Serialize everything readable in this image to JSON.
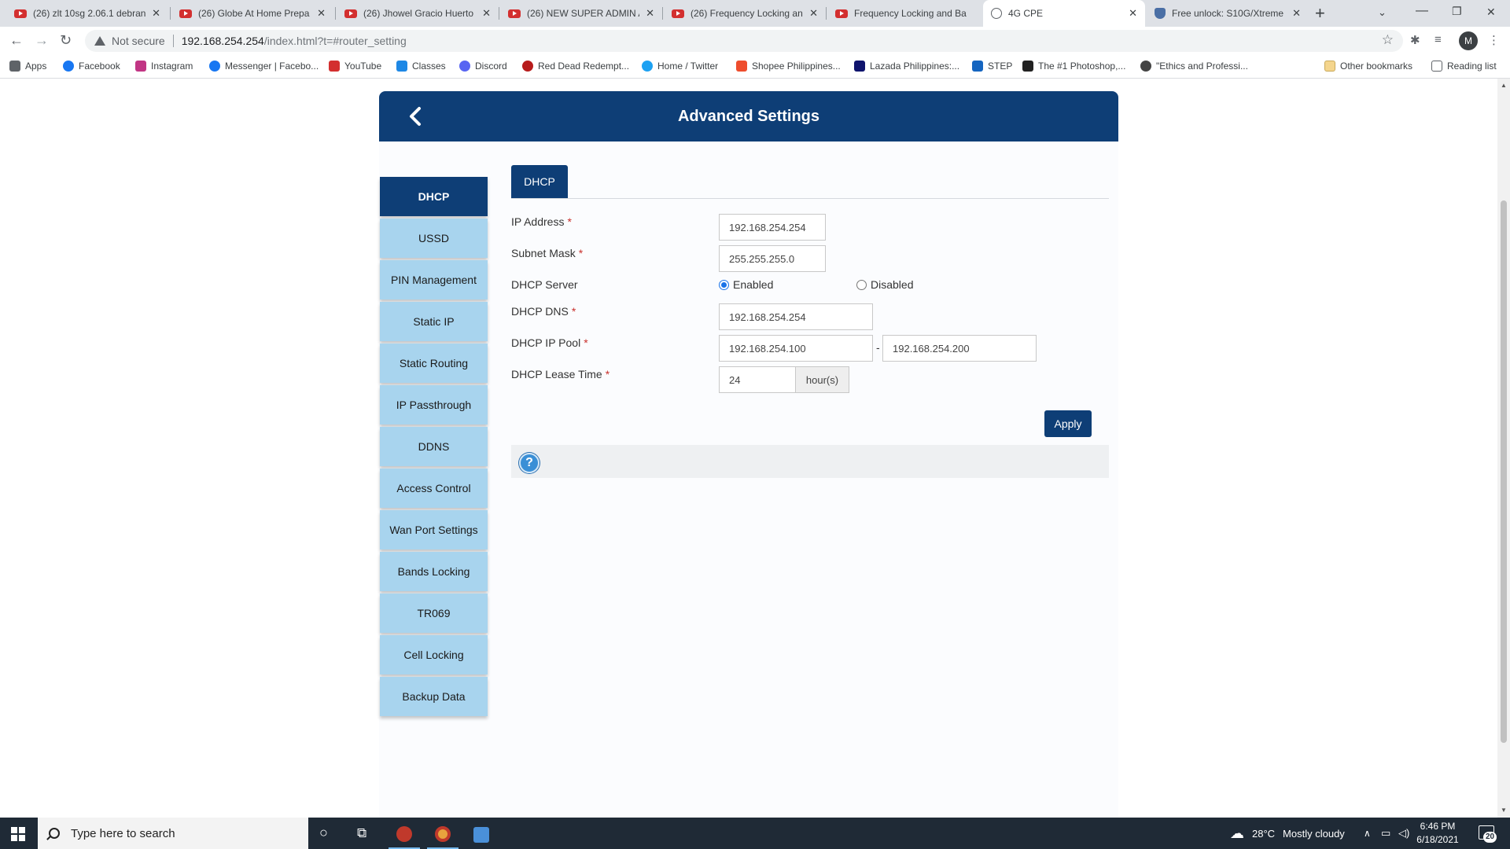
{
  "browser": {
    "tabs": [
      {
        "title": "(26) zlt 10sg 2.06.1 debran",
        "icon": "youtube-icon"
      },
      {
        "title": "(26) Globe At Home Prepa",
        "icon": "youtube-icon"
      },
      {
        "title": "(26) Jhowel Gracio Huerto",
        "icon": "youtube-icon"
      },
      {
        "title": "(26) NEW SUPER ADMIN A",
        "icon": "youtube-icon"
      },
      {
        "title": "(26) Frequency Locking an",
        "icon": "youtube-icon"
      },
      {
        "title": "Frequency Locking and Ba",
        "icon": "youtube-icon"
      },
      {
        "title": "4G CPE",
        "icon": "globe-icon"
      },
      {
        "title": "Free unlock: S10G/Xtreme",
        "icon": "shield-icon"
      }
    ],
    "new_tab_label": "+",
    "window_controls": {
      "minimize": "—",
      "restore": "❐",
      "close": "✕"
    },
    "nav": {
      "back": "←",
      "forward": "→",
      "reload": "↻"
    },
    "address_bar": {
      "security_label": "Not secure",
      "host": "192.168.254.254",
      "path": "/index.html?t=#router_setting"
    },
    "profile_initial": "M",
    "bookmarks": [
      {
        "label": "Apps",
        "color": "#5f6368"
      },
      {
        "label": "Facebook",
        "color": "#1877f2"
      },
      {
        "label": "Instagram",
        "color": "#c13584"
      },
      {
        "label": "Messenger | Facebo...",
        "color": "#1877f2"
      },
      {
        "label": "YouTube",
        "color": "#d32f2f"
      },
      {
        "label": "Classes",
        "color": "#1e88e5"
      },
      {
        "label": "Discord",
        "color": "#5865f2"
      },
      {
        "label": "Red Dead Redempt...",
        "color": "#b71c1c"
      },
      {
        "label": "Home / Twitter",
        "color": "#1da1f2"
      },
      {
        "label": "Shopee Philippines...",
        "color": "#ee4d2d"
      },
      {
        "label": "Lazada Philippines:...",
        "color": "#0f146d"
      },
      {
        "label": "STEP",
        "color": "#1565c0"
      },
      {
        "label": "The #1 Photoshop,...",
        "color": "#222222"
      },
      {
        "label": "\"Ethics and Professi...",
        "color": "#444444"
      }
    ],
    "other_bookmarks": "Other bookmarks",
    "reading_list": "Reading list"
  },
  "page": {
    "title": "Advanced Settings",
    "accent_color": "#0e3e76",
    "sidebar_color": "#a8d4ee",
    "sidebar": [
      {
        "label": "DHCP",
        "active": true
      },
      {
        "label": "USSD",
        "active": false
      },
      {
        "label": "PIN Management",
        "active": false
      },
      {
        "label": "Static IP",
        "active": false
      },
      {
        "label": "Static Routing",
        "active": false
      },
      {
        "label": "IP Passthrough",
        "active": false
      },
      {
        "label": "DDNS",
        "active": false
      },
      {
        "label": "Access Control",
        "active": false
      },
      {
        "label": "Wan Port Settings",
        "active": false
      },
      {
        "label": "Bands Locking",
        "active": false
      },
      {
        "label": "TR069",
        "active": false
      },
      {
        "label": "Cell Locking",
        "active": false
      },
      {
        "label": "Backup Data",
        "active": false
      }
    ],
    "sub_tab": "DHCP",
    "form": {
      "ip_address": {
        "label": "IP Address",
        "value": "192.168.254.254"
      },
      "subnet_mask": {
        "label": "Subnet Mask",
        "value": "255.255.255.0"
      },
      "dhcp_server": {
        "label": "DHCP Server",
        "enabled_label": "Enabled",
        "disabled_label": "Disabled",
        "selected": "Enabled"
      },
      "dhcp_dns": {
        "label": "DHCP DNS",
        "value": "192.168.254.254"
      },
      "dhcp_ip_pool": {
        "label": "DHCP IP Pool",
        "start": "192.168.254.100",
        "separator": "-",
        "end": "192.168.254.200"
      },
      "dhcp_lease_time": {
        "label": "DHCP Lease Time",
        "value": "24",
        "unit": "hour(s)"
      },
      "required_mark": "*"
    },
    "apply_label": "Apply",
    "help_icon_glyph": "?"
  },
  "taskbar": {
    "search_placeholder": "Type here to search",
    "weather": {
      "temp": "28°C",
      "condition": "Mostly cloudy"
    },
    "time": "6:46 PM",
    "date": "6/18/2021",
    "notification_count": "20"
  }
}
